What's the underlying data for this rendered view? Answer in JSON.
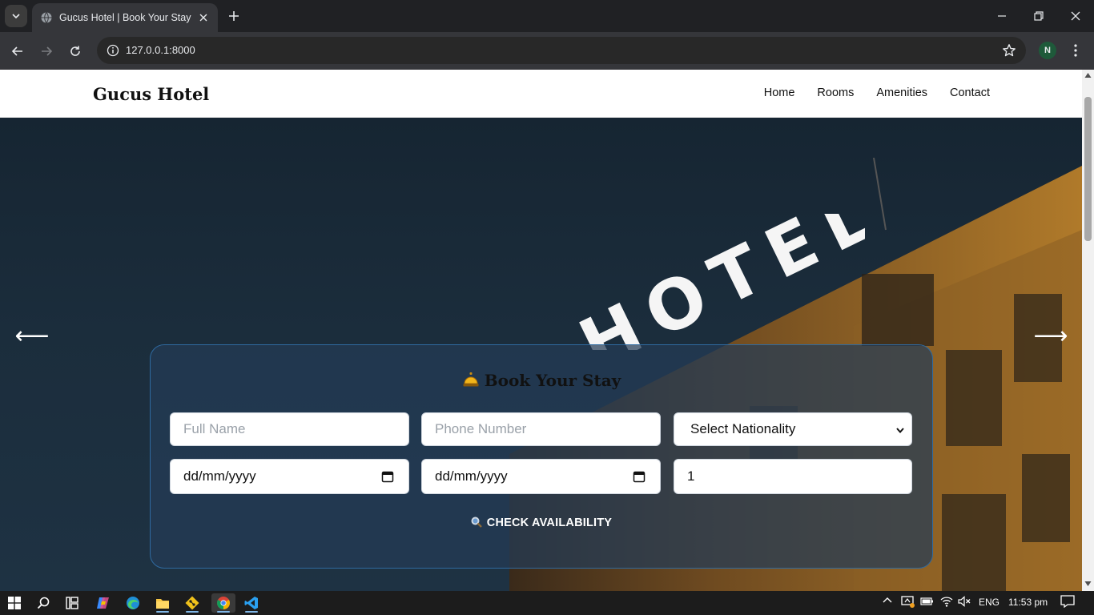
{
  "browser": {
    "tab_title": "Gucus Hotel | Book Your Stay",
    "url": "127.0.0.1:8000",
    "profile_initial": "N"
  },
  "site": {
    "brand": "Gucus Hotel",
    "nav": [
      "Home",
      "Rooms",
      "Amenities",
      "Contact"
    ]
  },
  "hero": {
    "sign_text": "HOTEL",
    "prev_arrow": "⟵",
    "next_arrow": "⟶"
  },
  "booking": {
    "title": "Book Your Stay",
    "full_name_placeholder": "Full Name",
    "phone_placeholder": "Phone Number",
    "nationality_selected": "Select Nationality",
    "checkin_placeholder": "dd/mm/yyyy",
    "checkout_placeholder": "dd/mm/yyyy",
    "guests_value": "1",
    "submit_label": "CHECK AVAILABILITY"
  },
  "taskbar": {
    "language": "ENG",
    "time": "11:53 pm"
  },
  "colors": {
    "chrome_bg": "#202124",
    "toolbar_bg": "#35363a",
    "hero_bg": "#1b2d3c",
    "form_border": "#2f6aa0",
    "building": "#b07a2a"
  }
}
